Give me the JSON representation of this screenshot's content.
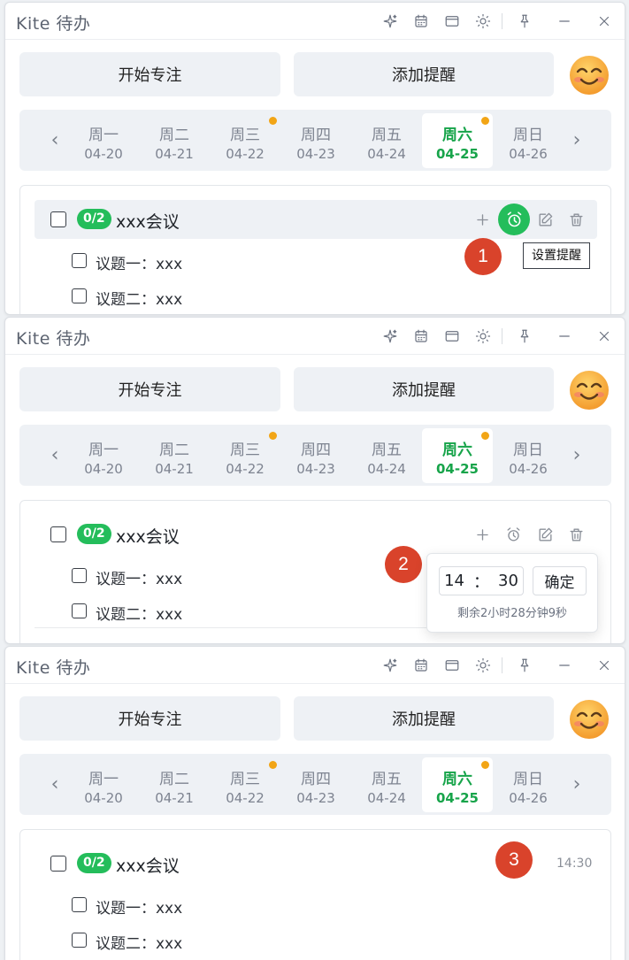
{
  "app": {
    "title": "Kite 待办"
  },
  "buttons": {
    "focus": "开始专注",
    "remind": "添加提醒"
  },
  "week": {
    "days": [
      {
        "name": "周一",
        "date": "04-20",
        "dot": false,
        "active": false
      },
      {
        "name": "周二",
        "date": "04-21",
        "dot": false,
        "active": false
      },
      {
        "name": "周三",
        "date": "04-22",
        "dot": true,
        "active": false
      },
      {
        "name": "周四",
        "date": "04-23",
        "dot": false,
        "active": false
      },
      {
        "name": "周五",
        "date": "04-24",
        "dot": false,
        "active": false
      },
      {
        "name": "周六",
        "date": "04-25",
        "dot": true,
        "active": true
      },
      {
        "name": "周日",
        "date": "04-26",
        "dot": false,
        "active": false
      }
    ]
  },
  "task": {
    "badge": "0/2",
    "title": "xxx会议",
    "subtasks": [
      "议题一：xxx",
      "议题二：xxx"
    ]
  },
  "tooltip": {
    "text": "设置提醒"
  },
  "popover": {
    "hour": "14",
    "sep": "：",
    "minute": "30",
    "confirm": "确定",
    "remaining": "剩余2小时28分钟9秒"
  },
  "reminder_time": "14:30",
  "steps": [
    "1",
    "2",
    "3"
  ],
  "colors": {
    "accent": "#24bd5b",
    "step": "#d9432b",
    "dot": "#f2a516"
  }
}
